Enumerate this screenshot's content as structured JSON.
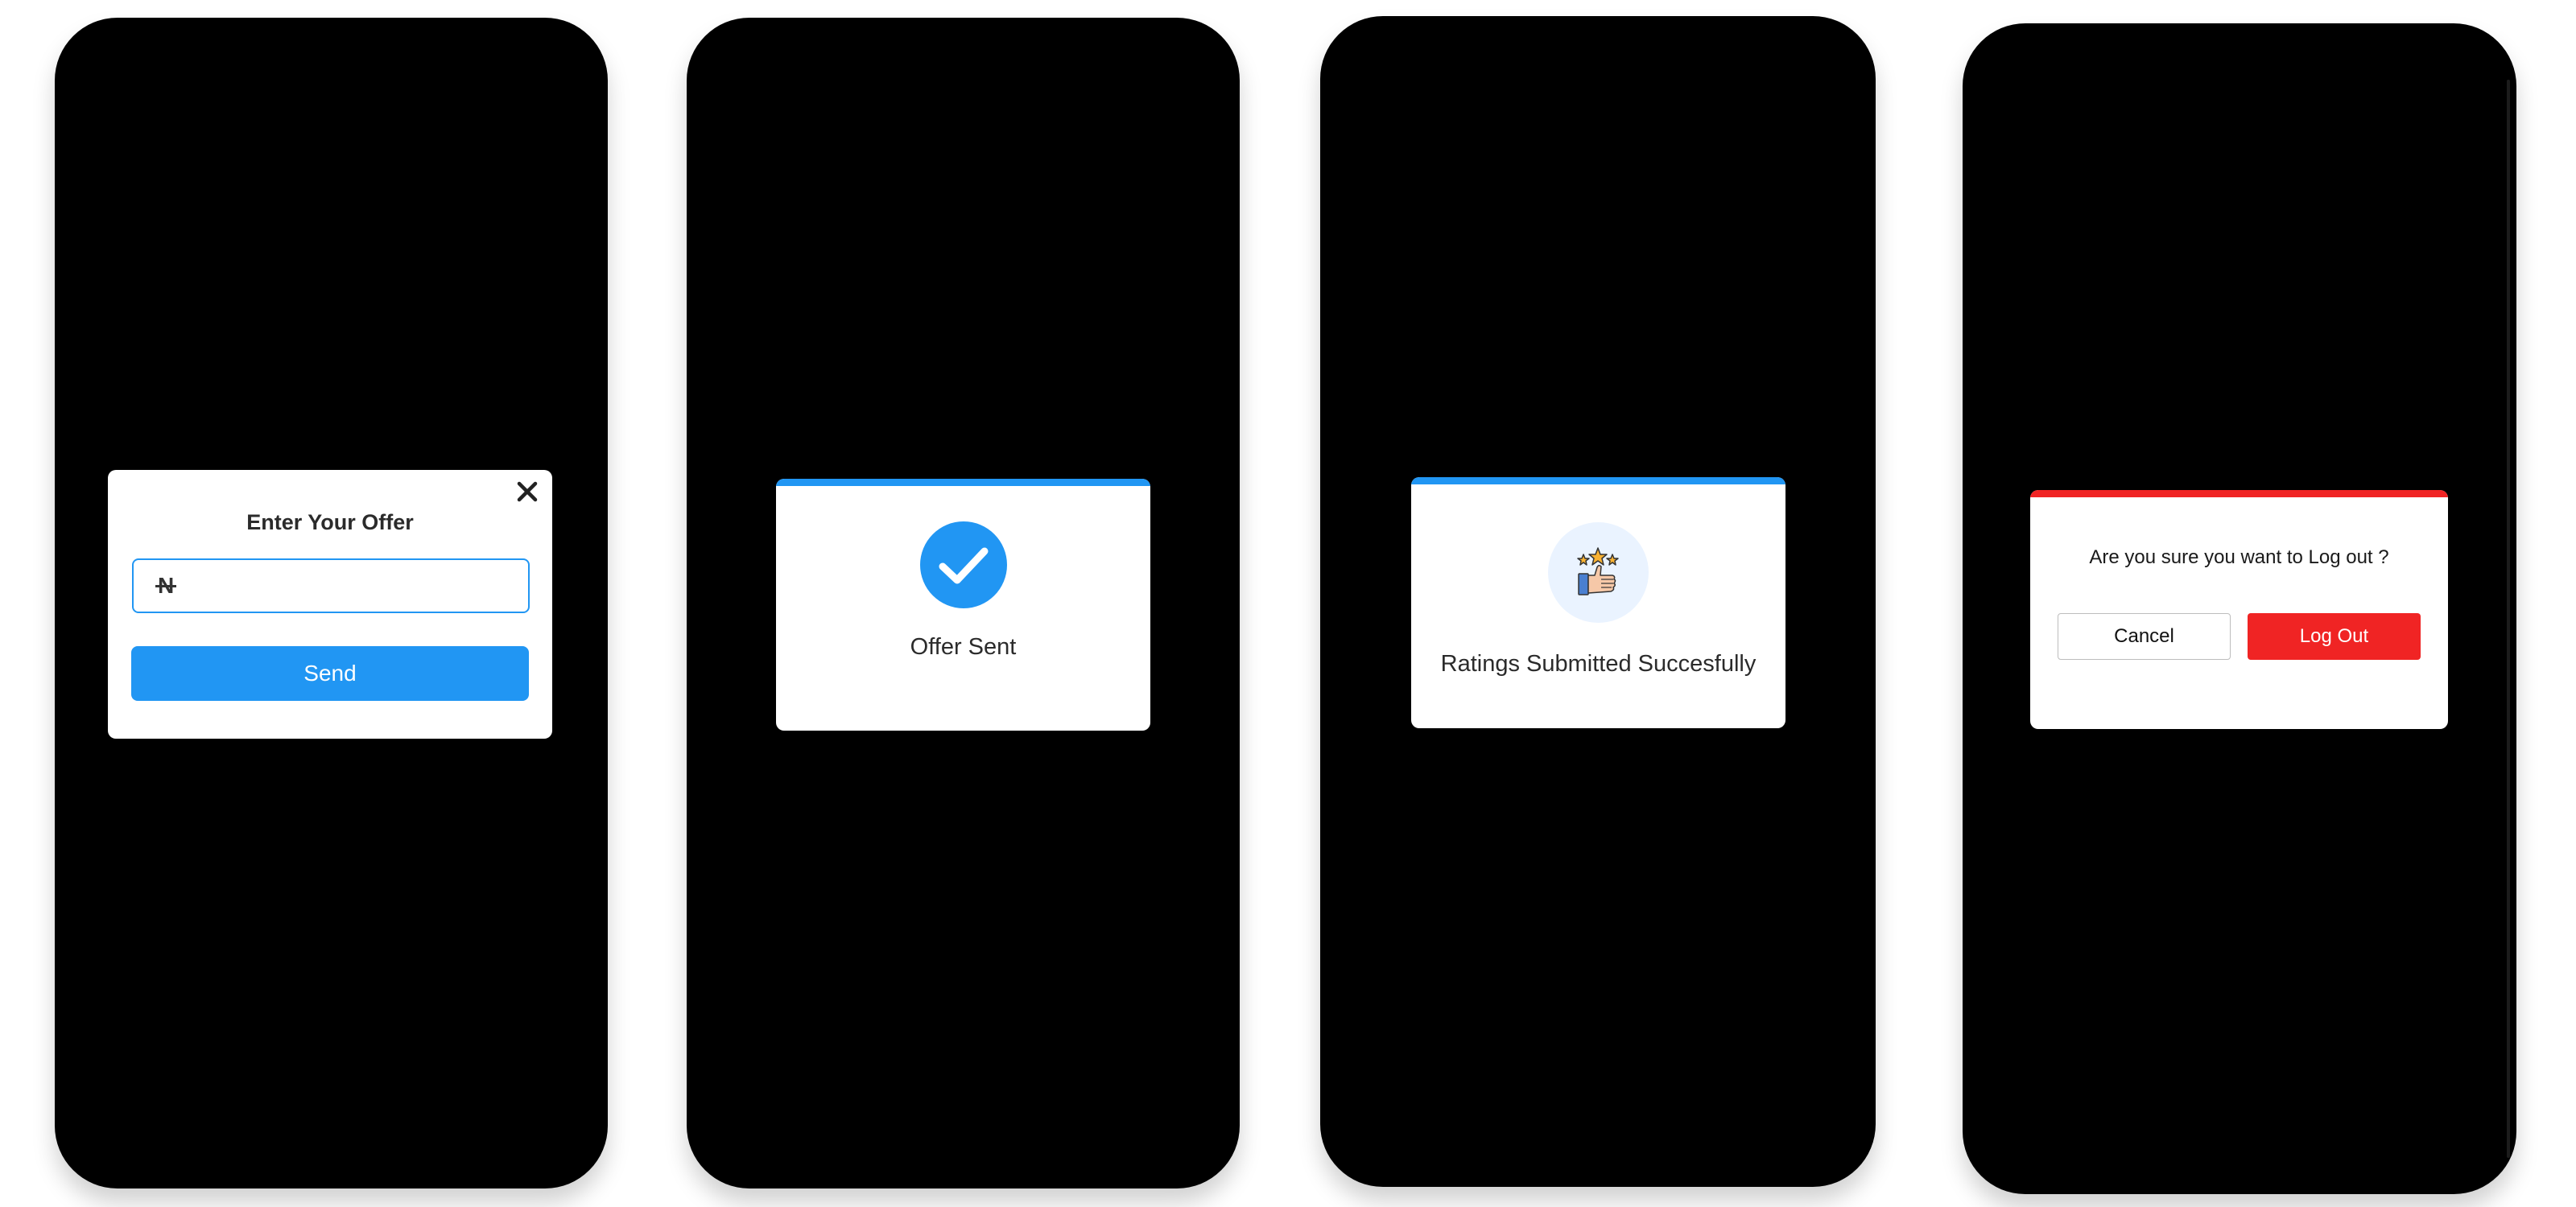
{
  "colors": {
    "primary": "#2196F3",
    "danger": "#F02424",
    "screen_background": "#000000",
    "card_background": "#FFFFFF"
  },
  "screens": [
    {
      "offer_dialog": {
        "title": "Enter Your Offer",
        "currency_symbol": "N",
        "input_value": "",
        "send_label": "Send",
        "close_icon": "close-icon"
      }
    },
    {
      "offer_sent_dialog": {
        "icon": "checkmark-icon",
        "message": "Offer Sent"
      }
    },
    {
      "ratings_dialog": {
        "icon": "thumbs-up-stars-icon",
        "message": "Ratings Submitted Succesfully"
      }
    },
    {
      "logout_dialog": {
        "question": "Are you sure you want to Log out ?",
        "cancel_label": "Cancel",
        "confirm_label": "Log Out"
      }
    }
  ]
}
